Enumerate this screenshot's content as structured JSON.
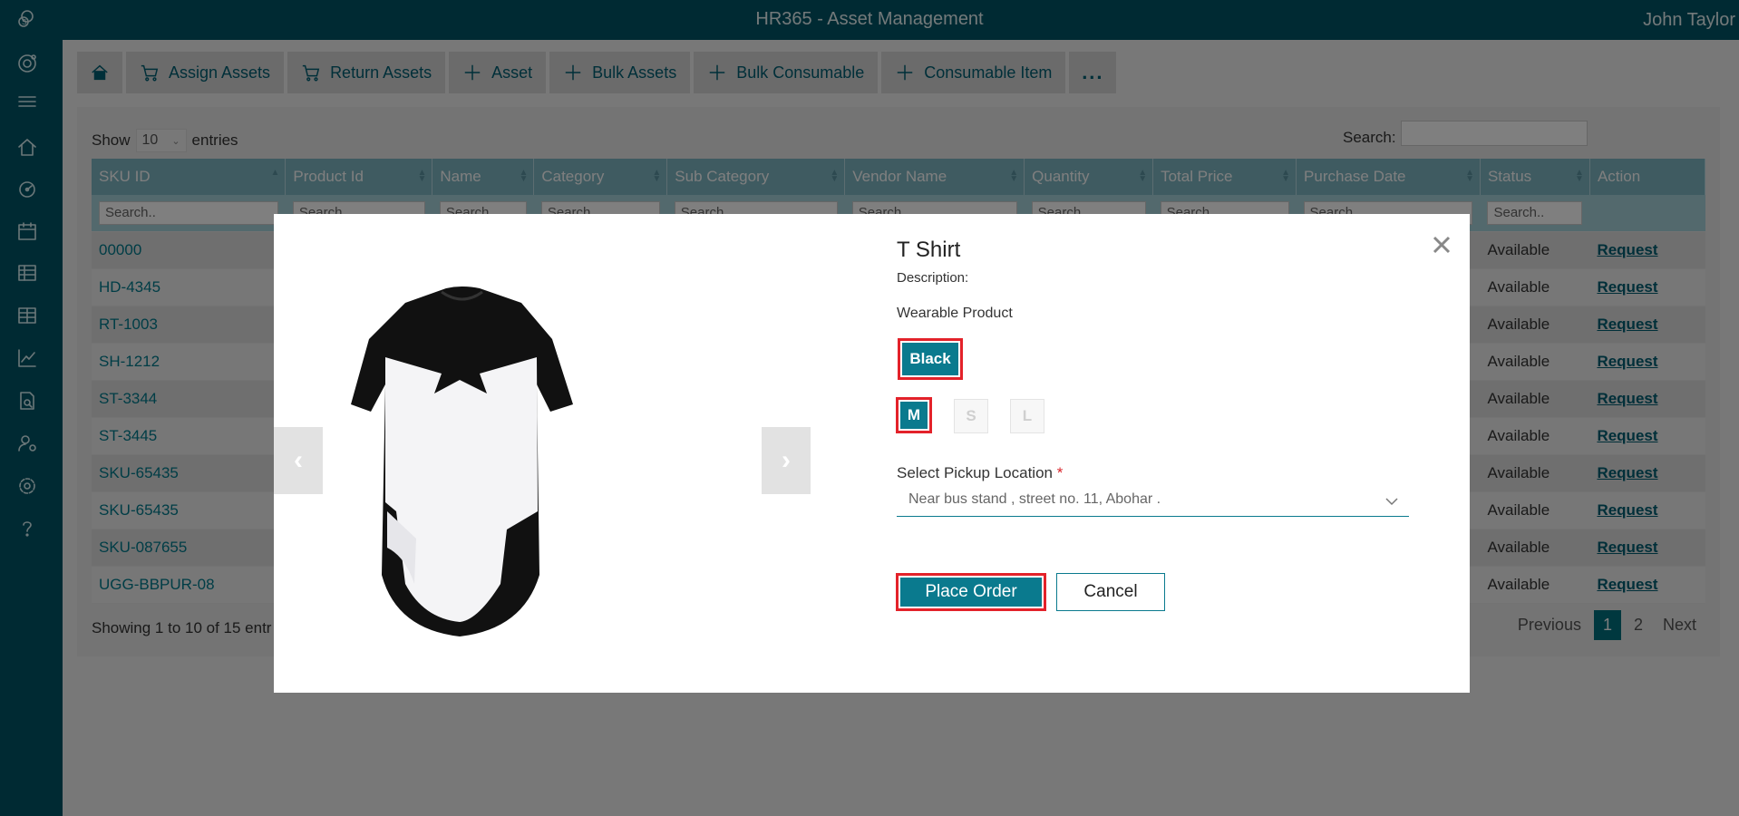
{
  "app": {
    "title": "HR365 - Asset Management",
    "user": "John Taylor"
  },
  "toolbar": {
    "assign": "Assign Assets",
    "return": "Return Assets",
    "asset": "Asset",
    "bulk_assets": "Bulk Assets",
    "bulk_consumable": "Bulk Consumable",
    "consumable_item": "Consumable Item",
    "more": "..."
  },
  "table_controls": {
    "show": "Show",
    "entries_value": "10",
    "entries": "entries",
    "search_label": "Search:"
  },
  "columns": [
    "SKU ID",
    "Product Id",
    "Name",
    "Category",
    "Sub Category",
    "Vendor Name",
    "Quantity",
    "Total Price",
    "Purchase Date",
    "Status",
    "Action"
  ],
  "filter_placeholder": "Search..",
  "rows": [
    {
      "sku": "00000",
      "status": "Available",
      "action": "Request"
    },
    {
      "sku": "HD-4345",
      "status": "Available",
      "action": "Request"
    },
    {
      "sku": "RT-1003",
      "status": "Available",
      "action": "Request"
    },
    {
      "sku": "SH-1212",
      "status": "Available",
      "action": "Request"
    },
    {
      "sku": "ST-3344",
      "status": "Available",
      "action": "Request"
    },
    {
      "sku": "ST-3445",
      "status": "Available",
      "action": "Request"
    },
    {
      "sku": "SKU-65435",
      "status": "Available",
      "action": "Request"
    },
    {
      "sku": "SKU-65435",
      "status": "Available",
      "action": "Request"
    },
    {
      "sku": "SKU-087655",
      "status": "Available",
      "action": "Request"
    },
    {
      "sku": "UGG-BBPUR-08",
      "status": "Available",
      "action": "Request"
    }
  ],
  "footer": {
    "showing": "Showing 1 to 10 of 15 entr",
    "previous": "Previous",
    "page1": "1",
    "page2": "2",
    "next": "Next"
  },
  "modal": {
    "title": "T Shirt",
    "description_label": "Description:",
    "description": "Wearable Product",
    "color": "Black",
    "sizes": [
      "M",
      "S",
      "L"
    ],
    "pickup_label": "Select Pickup Location",
    "required_mark": "*",
    "pickup_value": "Near bus stand , street no. 11, Abohar .",
    "place_order": "Place Order",
    "cancel": "Cancel",
    "prev_arrow": "‹",
    "next_arrow": "›"
  },
  "colors": {
    "brand": "#005566",
    "accent": "#0a7a8e",
    "highlight": "#e3222a"
  }
}
